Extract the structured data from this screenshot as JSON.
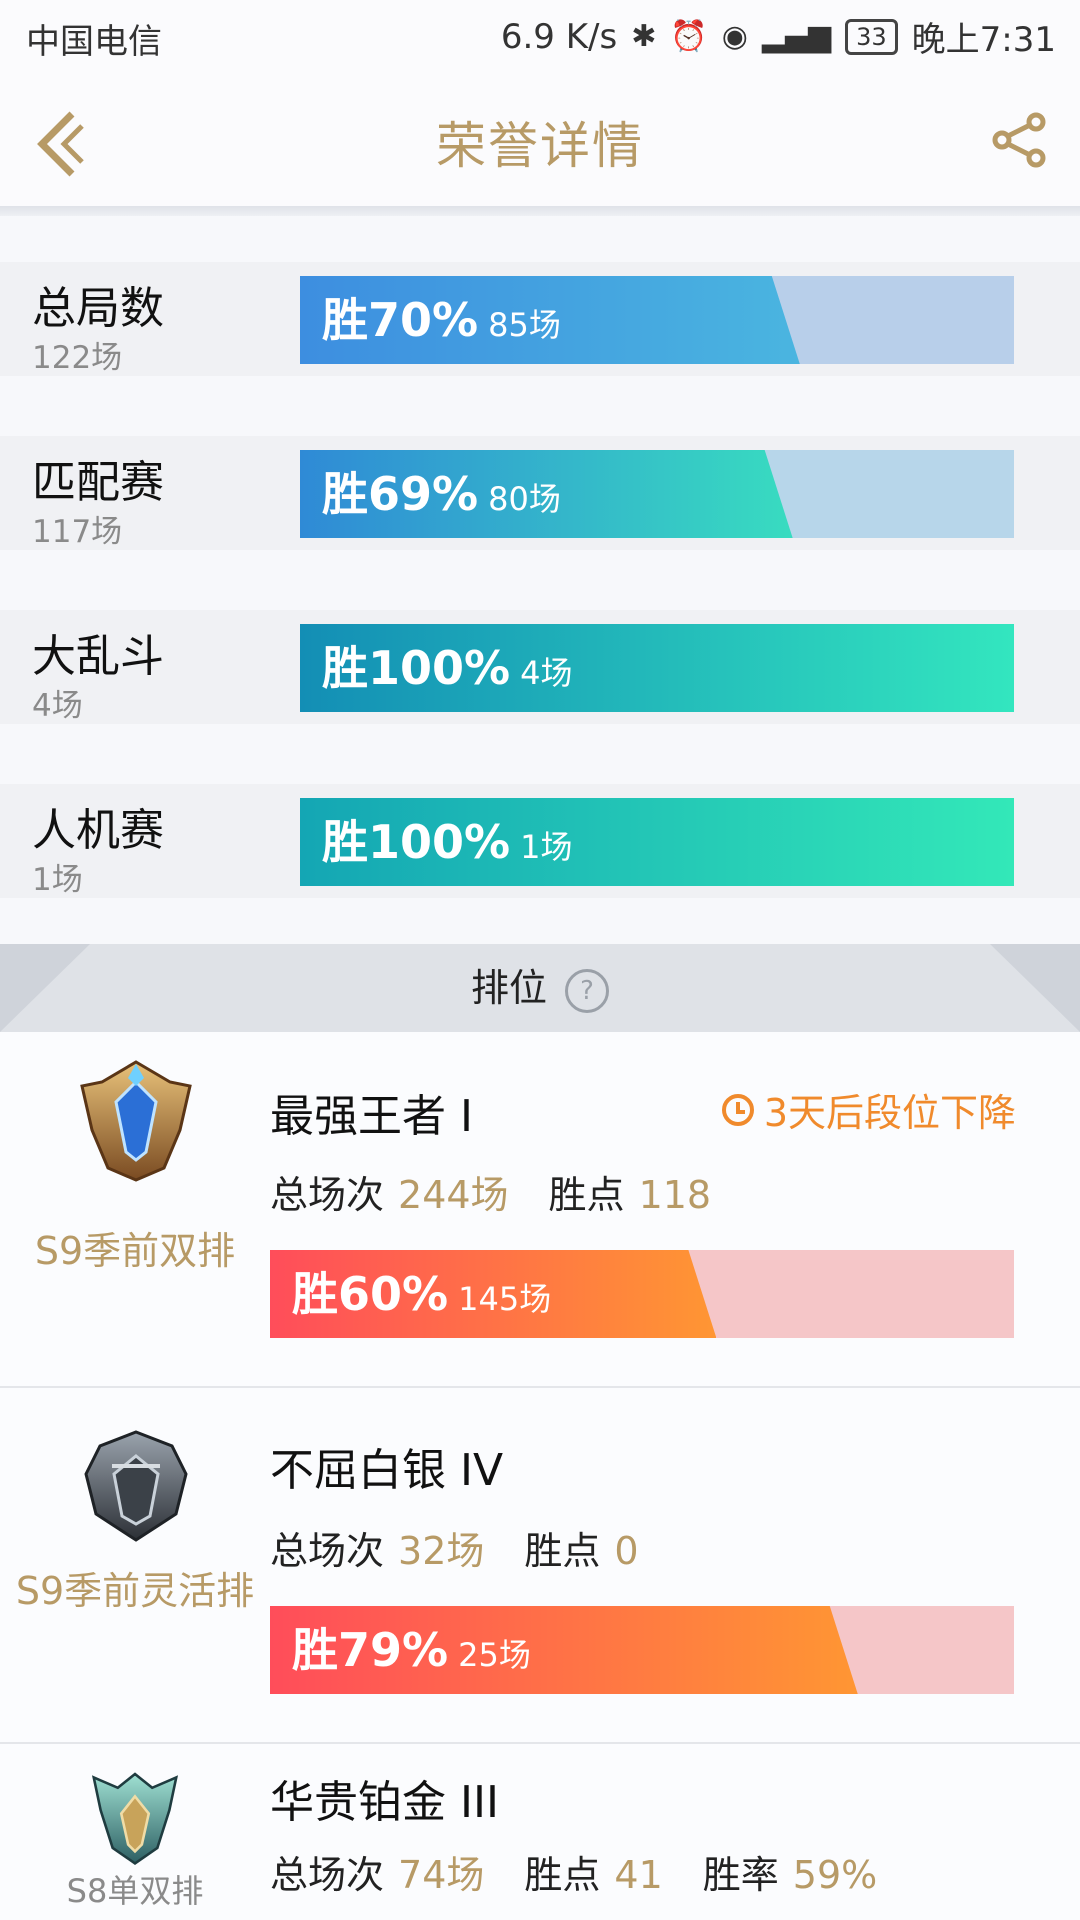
{
  "status_bar": {
    "carrier": "中国电信",
    "speed": "6.9 K/s",
    "icons": [
      "bluetooth-icon",
      "alarm-icon",
      "eye-icon",
      "signal-4g-icon"
    ],
    "battery": "33",
    "time": "晚上7:31"
  },
  "header": {
    "title": "荣誉详情",
    "back_icon": "chevron-left-icon",
    "share_icon": "share-icon"
  },
  "modes": [
    {
      "name": "总局数",
      "total": "122场",
      "win_label": "胜70%",
      "wins": "85场",
      "win_rate": 0.7,
      "fill_color_start": "#3d8ee0",
      "fill_color_end": "#4ab5e0",
      "track_color": "#b8cfea"
    },
    {
      "name": "匹配赛",
      "total": "117场",
      "win_label": "胜69%",
      "wins": "80场",
      "win_rate": 0.69,
      "fill_color_start": "#2f8ad6",
      "fill_color_end": "#38dcc0",
      "track_color": "#b7d6ea"
    },
    {
      "name": "大乱斗",
      "total": "4场",
      "win_label": "胜100%",
      "wins": "4场",
      "win_rate": 1.0,
      "fill_color_start": "#138eb5",
      "fill_color_end": "#33e6bf",
      "track_color": "#b7e3e6"
    },
    {
      "name": "人机赛",
      "total": "1场",
      "win_label": "胜100%",
      "wins": "1场",
      "win_rate": 1.0,
      "fill_color_start": "#14a6b4",
      "fill_color_end": "#33e8b8",
      "track_color": "#b7e3e6"
    }
  ],
  "ranked": {
    "title": "排位",
    "help_icon": "question-circle-icon",
    "entries": [
      {
        "emblem": "challenger-emblem-icon",
        "season": "S9季前双排",
        "tier": "最强王者 I",
        "demotion_note": "3天后段位下降",
        "total_label": "总场次",
        "total": "244场",
        "lp_label": "胜点",
        "lp": "118",
        "win_label": "胜60%",
        "wins": "145场",
        "win_rate": 0.6
      },
      {
        "emblem": "iron-emblem-icon",
        "season": "S9季前灵活排",
        "tier": "不屈白银 IV",
        "total_label": "总场次",
        "total": "32场",
        "lp_label": "胜点",
        "lp": "0",
        "win_label": "胜79%",
        "wins": "25场",
        "win_rate": 0.79
      },
      {
        "emblem": "platinum-emblem-icon",
        "season": "S8单双排",
        "tier": "华贵铂金 III",
        "total_label": "总场次",
        "total": "74场",
        "lp_label": "胜点",
        "lp": "41",
        "rate_label": "胜率",
        "rate": "59%"
      }
    ]
  },
  "colors": {
    "accent_gold": "#b79a66",
    "rank_fill_start": "#ff4d5a",
    "rank_fill_end": "#ff9633",
    "rank_track": "#f5c6c8",
    "demote_orange": "#f08a2c"
  }
}
